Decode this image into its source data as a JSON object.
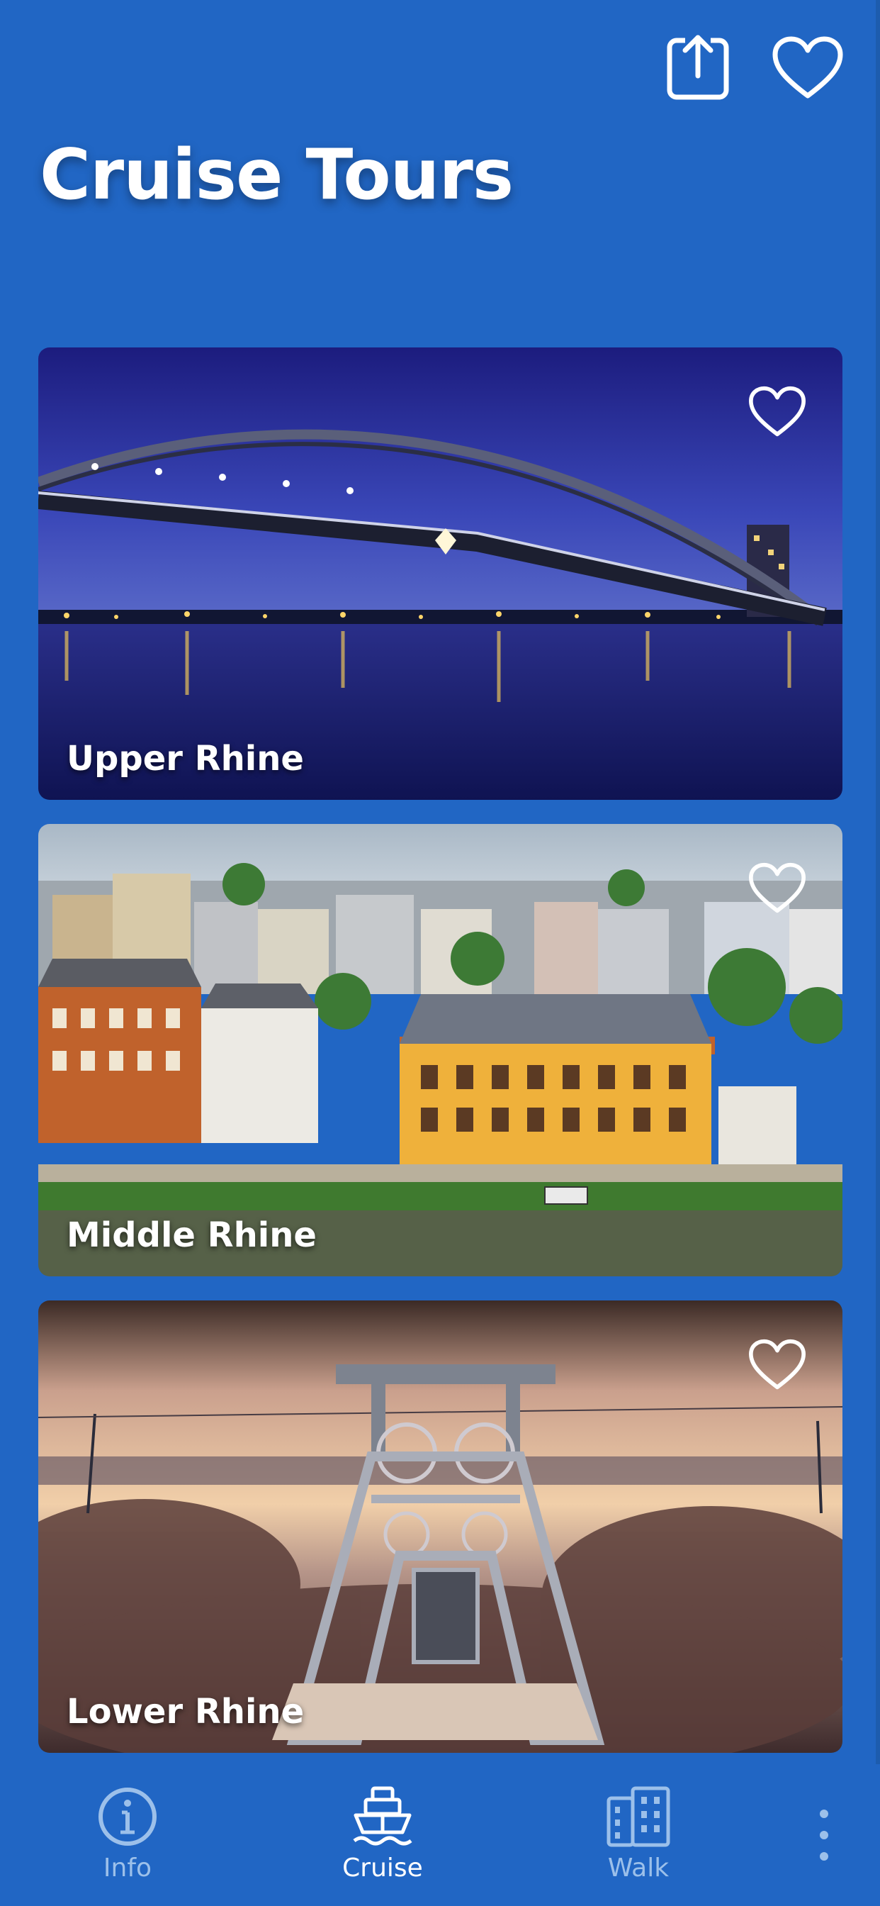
{
  "header": {
    "title": "Cruise Tours",
    "share_icon": "share-icon",
    "favorite_icon": "heart-outline-icon"
  },
  "tours": [
    {
      "label": "Upper Rhine",
      "favorite_icon": "heart-outline-icon"
    },
    {
      "label": "Middle Rhine",
      "favorite_icon": "heart-outline-icon"
    },
    {
      "label": "Lower Rhine",
      "favorite_icon": "heart-outline-icon"
    }
  ],
  "nav": {
    "items": [
      {
        "label": "Info",
        "icon": "info-icon",
        "active": false
      },
      {
        "label": "Cruise",
        "icon": "ship-icon",
        "active": true
      },
      {
        "label": "Walk",
        "icon": "buildings-icon",
        "active": false
      }
    ],
    "more_icon": "more-vertical-icon"
  },
  "colors": {
    "background": "#2166c4",
    "nav_inactive": "#9cc0ea",
    "text": "#ffffff"
  }
}
